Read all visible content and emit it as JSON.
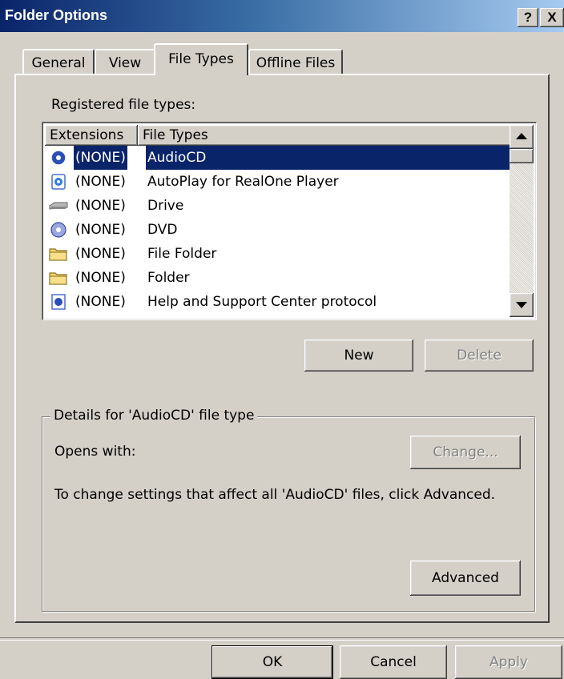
{
  "window": {
    "title": "Folder Options",
    "help_btn": "?",
    "close_btn": "X"
  },
  "tabs": [
    {
      "label": "General",
      "active": false
    },
    {
      "label": "View",
      "active": false
    },
    {
      "label": "File Types",
      "active": true
    },
    {
      "label": "Offline Files",
      "active": false
    }
  ],
  "registered_label": "Registered file types:",
  "list": {
    "columns": [
      "Extensions",
      "File Types"
    ],
    "rows": [
      {
        "ext": "(NONE)",
        "type": "AudioCD",
        "icon": "audio-cd-icon",
        "selected": true
      },
      {
        "ext": "(NONE)",
        "type": "AutoPlay for RealOne Player",
        "icon": "realone-icon",
        "selected": false
      },
      {
        "ext": "(NONE)",
        "type": "Drive",
        "icon": "drive-icon",
        "selected": false
      },
      {
        "ext": "(NONE)",
        "type": "DVD",
        "icon": "dvd-icon",
        "selected": false
      },
      {
        "ext": "(NONE)",
        "type": "File Folder",
        "icon": "folder-icon",
        "selected": false
      },
      {
        "ext": "(NONE)",
        "type": "Folder",
        "icon": "folder-icon",
        "selected": false
      },
      {
        "ext": "(NONE)",
        "type": "Help and Support Center protocol",
        "icon": "help-protocol-icon",
        "selected": false
      }
    ]
  },
  "buttons": {
    "new": "New",
    "delete": "Delete",
    "change": "Change...",
    "advanced": "Advanced",
    "ok": "OK",
    "cancel": "Cancel",
    "apply": "Apply"
  },
  "details": {
    "title": "Details for 'AudioCD' file type",
    "opens_with": "Opens with:",
    "info": "To change settings that affect all 'AudioCD' files, click Advanced."
  },
  "colors": {
    "selection": "#0a246a",
    "face": "#d4d0c8"
  }
}
